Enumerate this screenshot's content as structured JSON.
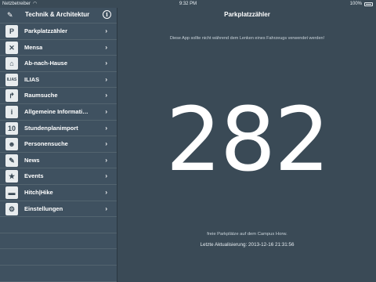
{
  "status_bar": {
    "carrier": "Netzbetreiber",
    "time": "9:32 PM",
    "battery": "100%"
  },
  "sidebar": {
    "title": "Technik & Architektur",
    "items": [
      {
        "label": "Parkplatzzähler",
        "icon": "parking-icon",
        "glyph": "P"
      },
      {
        "label": "Mensa",
        "icon": "cutlery-icon",
        "glyph": "✕"
      },
      {
        "label": "Ab-nach-Hause",
        "icon": "house-icon",
        "glyph": "⌂"
      },
      {
        "label": "ILIAS",
        "icon": "ilias-logo-icon",
        "glyph": "ILIAS"
      },
      {
        "label": "Raumsuche",
        "icon": "signpost-icon",
        "glyph": "↱"
      },
      {
        "label": "Allgemeine Informati…",
        "icon": "info-icon",
        "glyph": "i"
      },
      {
        "label": "Stundenplanimport",
        "icon": "calendar-icon",
        "glyph": "10"
      },
      {
        "label": "Personensuche",
        "icon": "people-icon",
        "glyph": "☻"
      },
      {
        "label": "News",
        "icon": "megaphone-icon",
        "glyph": "✎"
      },
      {
        "label": "Events",
        "icon": "star-icon",
        "glyph": "★"
      },
      {
        "label": "Hitch|Hike",
        "icon": "car-icon",
        "glyph": "▬"
      },
      {
        "label": "Einstellungen",
        "icon": "gear-icon",
        "glyph": "⚙"
      }
    ]
  },
  "main": {
    "title": "Parkplatzzähler",
    "warning": "Diese App sollte nicht während dem Lenken eines Fahrzeugs verwendet werden!",
    "count": "282",
    "free_label": "freie Parkplätze auf dem Campus Horw.",
    "updated": "Letzte Aktualisierung: 2013-12-16 21:31:56"
  }
}
